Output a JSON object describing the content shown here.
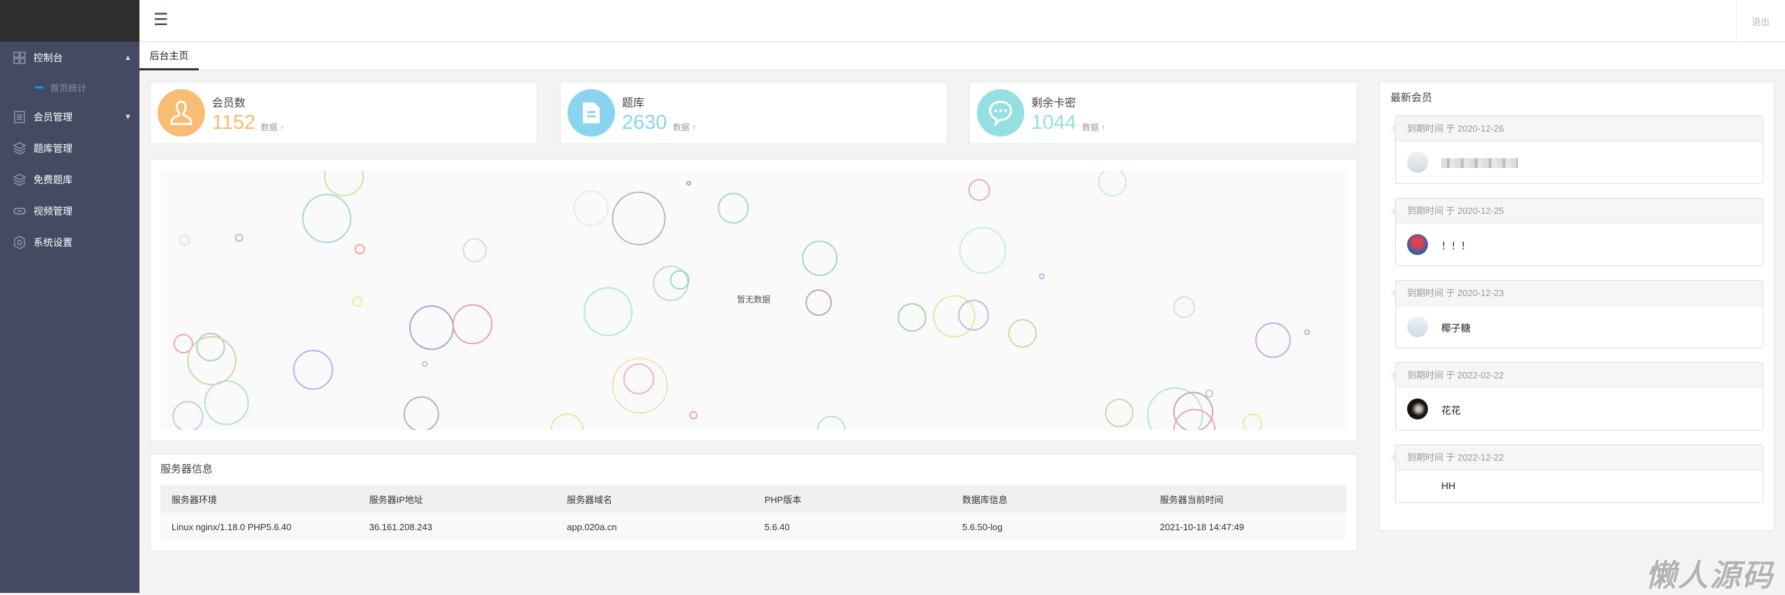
{
  "header": {
    "menu_icon": "hamburger-icon",
    "logout": "退出"
  },
  "sidebar": {
    "items": [
      {
        "label": "控制台",
        "icon": "grid-icon",
        "expanded": true
      },
      {
        "label": "会员管理",
        "icon": "list-icon",
        "expanded": false
      },
      {
        "label": "题库管理",
        "icon": "layers-icon"
      },
      {
        "label": "免费题库",
        "icon": "layers-icon"
      },
      {
        "label": "视频管理",
        "icon": "link-icon"
      },
      {
        "label": "系统设置",
        "icon": "gear-icon"
      }
    ],
    "sub_items": [
      {
        "label": "首页统计"
      }
    ]
  },
  "tabs": [
    {
      "label": "后台主页",
      "active": true
    }
  ],
  "stats": [
    {
      "title": "会员数",
      "value": "1152",
      "more": "数据",
      "color": "#f8bc73",
      "icon": "user-icon"
    },
    {
      "title": "题库",
      "value": "2630",
      "more": "数据",
      "color": "#8ad4f0",
      "icon": "document-icon"
    },
    {
      "title": "剩余卡密",
      "value": "1044",
      "more": "数据",
      "color": "#94e0e0",
      "icon": "chat-icon"
    }
  ],
  "chart": {
    "empty_text": "暂无数据"
  },
  "server": {
    "title": "服务器信息",
    "headers": [
      "服务器环境",
      "服务器IP地址",
      "服务器域名",
      "PHP版本",
      "数据库信息",
      "服务器当前时间"
    ],
    "row": [
      "Linux nginx/1.18.0 PHP5.6.40",
      "36.161.208.243",
      "app.020a.cn",
      "5.6.40",
      "5.6.50-log",
      "2021-10-18 14:47:49"
    ]
  },
  "members": {
    "title": "最新会员",
    "prefix": "到期时间",
    "sep": "于",
    "items": [
      {
        "date": "2020-12-26",
        "name": "",
        "avatar": "placeholder"
      },
      {
        "date": "2020-12-25",
        "name": "！！！",
        "avatar": "photo"
      },
      {
        "date": "2020-12-23",
        "name": "椰子糖",
        "avatar": "placeholder"
      },
      {
        "date": "2022-02-22",
        "name": "花花",
        "avatar": "dark-photo"
      },
      {
        "date": "2022-12-22",
        "name": "HH",
        "avatar": "none"
      }
    ]
  },
  "watermark": "懒人源码"
}
